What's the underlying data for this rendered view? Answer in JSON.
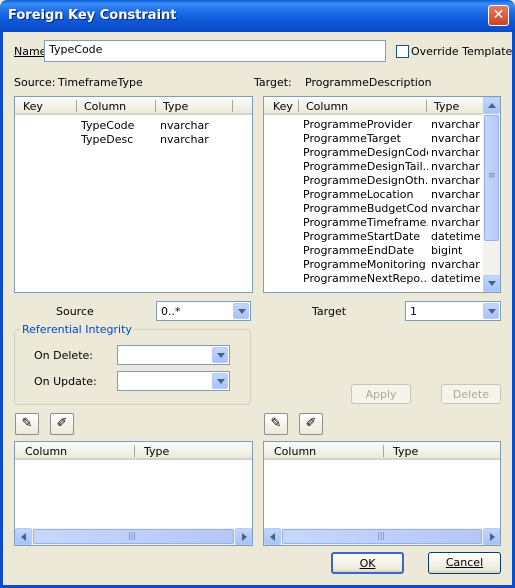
{
  "window": {
    "title": "Foreign Key Constraint",
    "close_glyph": "✕"
  },
  "name": {
    "label": "Name",
    "value": "TypeCode"
  },
  "override_template": {
    "label": "Override Template",
    "checked": false
  },
  "source": {
    "label": "Source:",
    "table": "TimeframeType",
    "columns_header": [
      "Key",
      "Column",
      "Type"
    ],
    "rows": [
      {
        "key": "",
        "column": "TypeCode",
        "type": "nvarchar"
      },
      {
        "key": "",
        "column": "TypeDesc",
        "type": "nvarchar"
      }
    ]
  },
  "target": {
    "label": "Target:",
    "table": "ProgrammeDescription",
    "columns_header": [
      "Key",
      "Column",
      "Type"
    ],
    "rows": [
      {
        "key": "",
        "column": "ProgrammeProvider",
        "type": "nvarchar"
      },
      {
        "key": "",
        "column": "ProgrammeTarget",
        "type": "nvarchar"
      },
      {
        "key": "",
        "column": "ProgrammeDesignCode",
        "type": "nvarchar"
      },
      {
        "key": "",
        "column": "ProgrammeDesignTail...",
        "type": "nvarchar"
      },
      {
        "key": "",
        "column": "ProgrammeDesignOth...",
        "type": "nvarchar"
      },
      {
        "key": "",
        "column": "ProgrammeLocation",
        "type": "nvarchar"
      },
      {
        "key": "",
        "column": "ProgrammeBudgetCode",
        "type": "nvarchar"
      },
      {
        "key": "",
        "column": "ProgrammeTimeframe...",
        "type": "nvarchar"
      },
      {
        "key": "",
        "column": "ProgrammeStartDate",
        "type": "datetime"
      },
      {
        "key": "",
        "column": "ProgrammeEndDate",
        "type": "bigint"
      },
      {
        "key": "",
        "column": "ProgrammeMonitoring",
        "type": "nvarchar"
      },
      {
        "key": "",
        "column": "ProgrammeNextRepo...",
        "type": "datetime"
      }
    ]
  },
  "cardinality": {
    "source_label": "Source",
    "source_value": "0..*",
    "target_label": "Target",
    "target_value": "1"
  },
  "referential_integrity": {
    "title": "Referential Integrity",
    "on_delete_label": "On Delete:",
    "on_delete_value": "",
    "on_update_label": "On Update:",
    "on_update_value": ""
  },
  "buttons": {
    "apply": "Apply",
    "delete": "Delete",
    "ok": "OK",
    "cancel": "Cancel"
  },
  "lower_left": {
    "columns_header": [
      "Column",
      "Type"
    ],
    "rows": []
  },
  "lower_right": {
    "columns_header": [
      "Column",
      "Type"
    ],
    "rows": []
  },
  "icons": {
    "add": "pencil-add-icon",
    "remove": "pencil-remove-icon",
    "scroll_grip": "≡",
    "hscroll_grip": "|||"
  },
  "colors": {
    "titlebar": "#0a5fd8",
    "dialog_bg": "#ece9d8",
    "close": "#c9442a"
  }
}
